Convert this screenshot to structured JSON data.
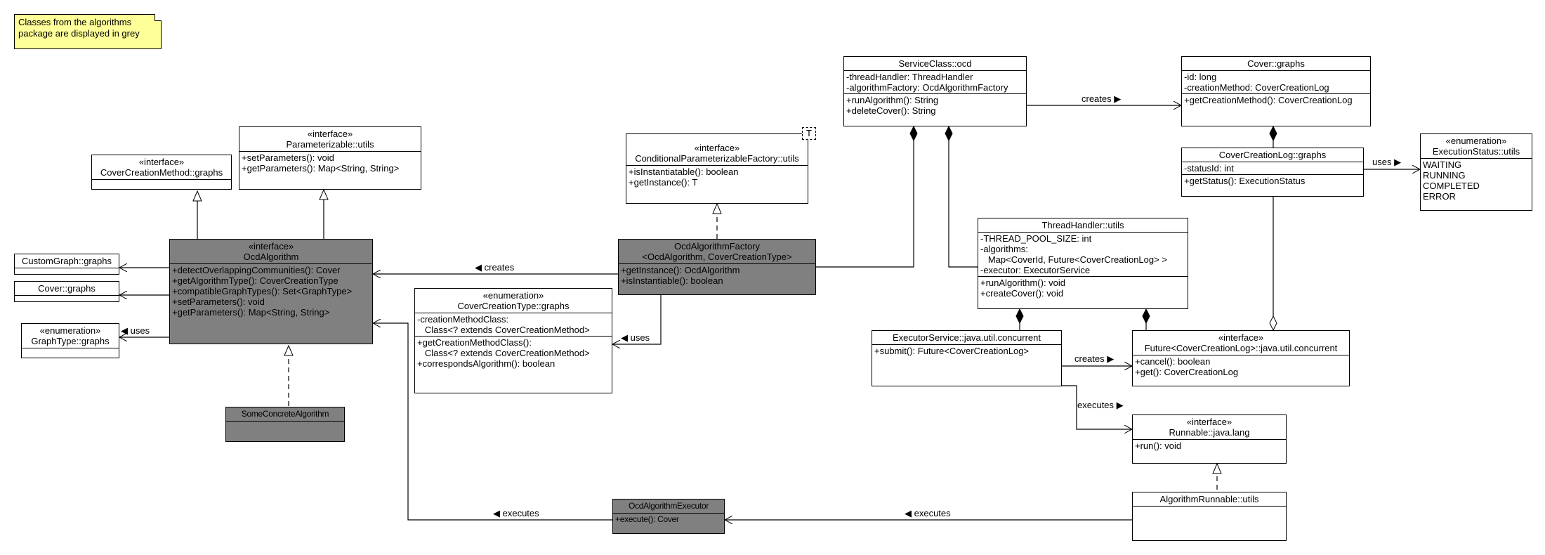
{
  "note": {
    "lines": [
      "Classes from the algorithms",
      "package are displayed in grey"
    ]
  },
  "colors": {
    "algorithm_package_fill": "#808080",
    "note_fill": "#ffff99",
    "default_fill": "#ffffff"
  },
  "classes": {
    "coverCreationMethod": {
      "stereotype": "«interface»",
      "name": "CoverCreationMethod::graphs",
      "attributes": [],
      "operations": []
    },
    "parameterizable": {
      "stereotype": "«interface»",
      "name": "Parameterizable::utils",
      "attributes": [],
      "operations": [
        "+setParameters(): void",
        "+getParameters(): Map<String, String>"
      ]
    },
    "customGraph": {
      "name": "CustomGraph::graphs",
      "attributes": [],
      "operations": []
    },
    "coverLeft": {
      "name": "Cover::graphs",
      "attributes": [],
      "operations": []
    },
    "graphType": {
      "stereotype": "«enumeration»",
      "name": "GraphType::graphs",
      "attributes": [],
      "operations": []
    },
    "ocdAlgorithm": {
      "stereotype": "«interface»",
      "name": "OcdAlgorithm",
      "attributes": [],
      "operations": [
        "+detectOverlappingCommunities(): Cover",
        "+getAlgorithmType(): CoverCreationType",
        "+compatibleGraphTypes(): Set<GraphType>",
        "+setParameters(): void",
        "+getParameters(): Map<String, String>"
      ]
    },
    "someConcreteAlgorithm": {
      "name": "SomeConcreteAlgorithm",
      "attributes": [],
      "operations": []
    },
    "conditionalFactory": {
      "stereotype": "«interface»",
      "name": "ConditionalParameterizableFactory::utils",
      "template_param": "T",
      "operations": [
        "+isInstantiatable(): boolean",
        "+getInstance(): T"
      ]
    },
    "ocdAlgorithmFactory": {
      "name": "OcdAlgorithmFactory",
      "name2": "<OcdAlgorithm, CoverCreationType>",
      "operations": [
        "+getInstance(): OcdAlgorithm",
        "+isInstantiable(): boolean"
      ]
    },
    "coverCreationType": {
      "stereotype": "«enumeration»",
      "name": "CoverCreationType::graphs",
      "attributes": [
        "-creationMethodClass:",
        "   Class<? extends CoverCreationMethod>"
      ],
      "operations": [
        "+getCreationMethodClass():",
        "   Class<? extends CoverCreationMethod>",
        "+correspondsAlgorithm(): boolean"
      ]
    },
    "ocdAlgorithmExecutor": {
      "name": "OcdAlgorithmExecutor",
      "operations": [
        "+execute(): Cover"
      ]
    },
    "serviceClass": {
      "name": "ServiceClass::ocd",
      "attributes": [
        "-threadHandler: ThreadHandler",
        "-algorithmFactory: OcdAlgorithmFactory"
      ],
      "operations": [
        "+runAlgorithm(): String",
        "+deleteCover(): String"
      ]
    },
    "coverRight": {
      "name": "Cover::graphs",
      "attributes": [
        "-id: long",
        "-creationMethod: CoverCreationLog"
      ],
      "operations": [
        "+getCreationMethod(): CoverCreationLog"
      ]
    },
    "coverCreationLog": {
      "name": "CoverCreationLog::graphs",
      "attributes": [
        "-statusId: int"
      ],
      "operations": [
        "+getStatus(): ExecutionStatus"
      ]
    },
    "executionStatus": {
      "stereotype": "«enumeration»",
      "name": "ExecutionStatus::utils",
      "literals": [
        "WAITING",
        "RUNNING",
        "COMPLETED",
        "ERROR"
      ]
    },
    "threadHandler": {
      "name": "ThreadHandler::utils",
      "attributes": [
        "-THREAD_POOL_SIZE: int",
        "-algorithms:",
        "   Map<CoverId, Future<CoverCreationLog> >",
        "-executor: ExecutorService"
      ],
      "operations": [
        "+runAlgorithm(): void",
        "+createCover(): void"
      ]
    },
    "executorService": {
      "name": "ExecutorService::java.util.concurrent",
      "operations": [
        "+submit(): Future<CoverCreationLog>"
      ]
    },
    "future": {
      "stereotype": "«interface»",
      "name": "Future<CoverCreationLog>::java.util.concurrent",
      "operations": [
        "+cancel(): boolean",
        "+get(): CoverCreationLog"
      ]
    },
    "runnable": {
      "stereotype": "«interface»",
      "name": "Runnable::java.lang",
      "operations": [
        "+run(): void"
      ]
    },
    "algorithmRunnable": {
      "name": "AlgorithmRunnable::utils",
      "operations": []
    }
  },
  "labels": {
    "factoryCreatesAlgorithm": "◀ creates",
    "algorithmUsesGraphType": "◀ uses",
    "factoryUsesCreationType": "◀ uses",
    "serviceCreatesCover": "creates ▶",
    "logUsesStatus": "uses ▶",
    "executorCreatesFuture": "creates ▶",
    "executorExecutesRunnable": "executes ▶",
    "executorExecutesAlgorithm": "◀ executes",
    "runnableExecutesExecutor": "◀ executes"
  }
}
